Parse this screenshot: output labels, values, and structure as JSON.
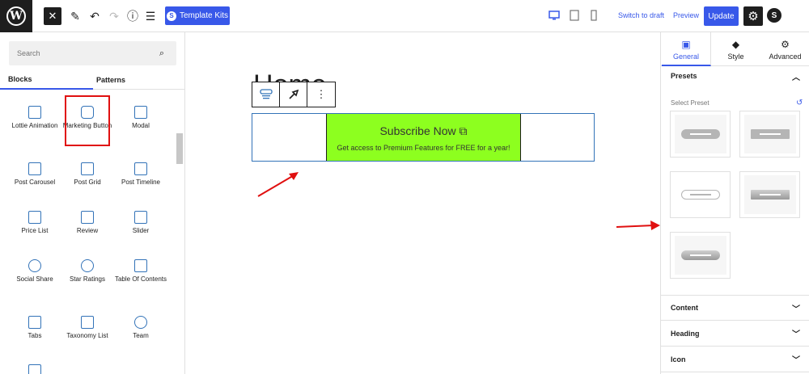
{
  "topbar": {
    "template_kits_label": "Template Kits",
    "switch_to_draft": "Switch to draft",
    "preview": "Preview",
    "update": "Update"
  },
  "inserter": {
    "search_placeholder": "Search",
    "tabs": [
      "Blocks",
      "Patterns"
    ],
    "blocks": [
      {
        "label": "Lottie Animation",
        "icon": "lottie-icon"
      },
      {
        "label": "Marketing Button",
        "icon": "marketing-button-icon"
      },
      {
        "label": "Modal",
        "icon": "modal-icon"
      },
      {
        "label": "Post Carousel",
        "icon": "post-carousel-icon"
      },
      {
        "label": "Post Grid",
        "icon": "post-grid-icon"
      },
      {
        "label": "Post Timeline",
        "icon": "post-timeline-icon"
      },
      {
        "label": "Price List",
        "icon": "price-list-icon"
      },
      {
        "label": "Review",
        "icon": "review-icon"
      },
      {
        "label": "Slider",
        "icon": "slider-icon"
      },
      {
        "label": "Social Share",
        "icon": "social-share-icon"
      },
      {
        "label": "Star Ratings",
        "icon": "star-ratings-icon"
      },
      {
        "label": "Table Of Contents",
        "icon": "table-of-contents-icon"
      },
      {
        "label": "Tabs",
        "icon": "tabs-icon"
      },
      {
        "label": "Taxonomy List",
        "icon": "taxonomy-list-icon"
      },
      {
        "label": "Team",
        "icon": "team-icon"
      },
      {
        "label": "",
        "icon": "testimonial-icon"
      }
    ]
  },
  "canvas": {
    "page_title": "Home",
    "cta_title": "Subscribe Now",
    "cta_subtitle": "Get access to Premium Features for FREE for a year!",
    "cta_color": "#8dff1f"
  },
  "settings": {
    "tabs": [
      "General",
      "Style",
      "Advanced"
    ],
    "presets_heading": "Presets",
    "select_preset": "Select Preset",
    "sections": [
      "Content",
      "Heading",
      "Icon"
    ]
  },
  "colors": {
    "accent": "#3858e9",
    "annotation": "#e01010"
  }
}
